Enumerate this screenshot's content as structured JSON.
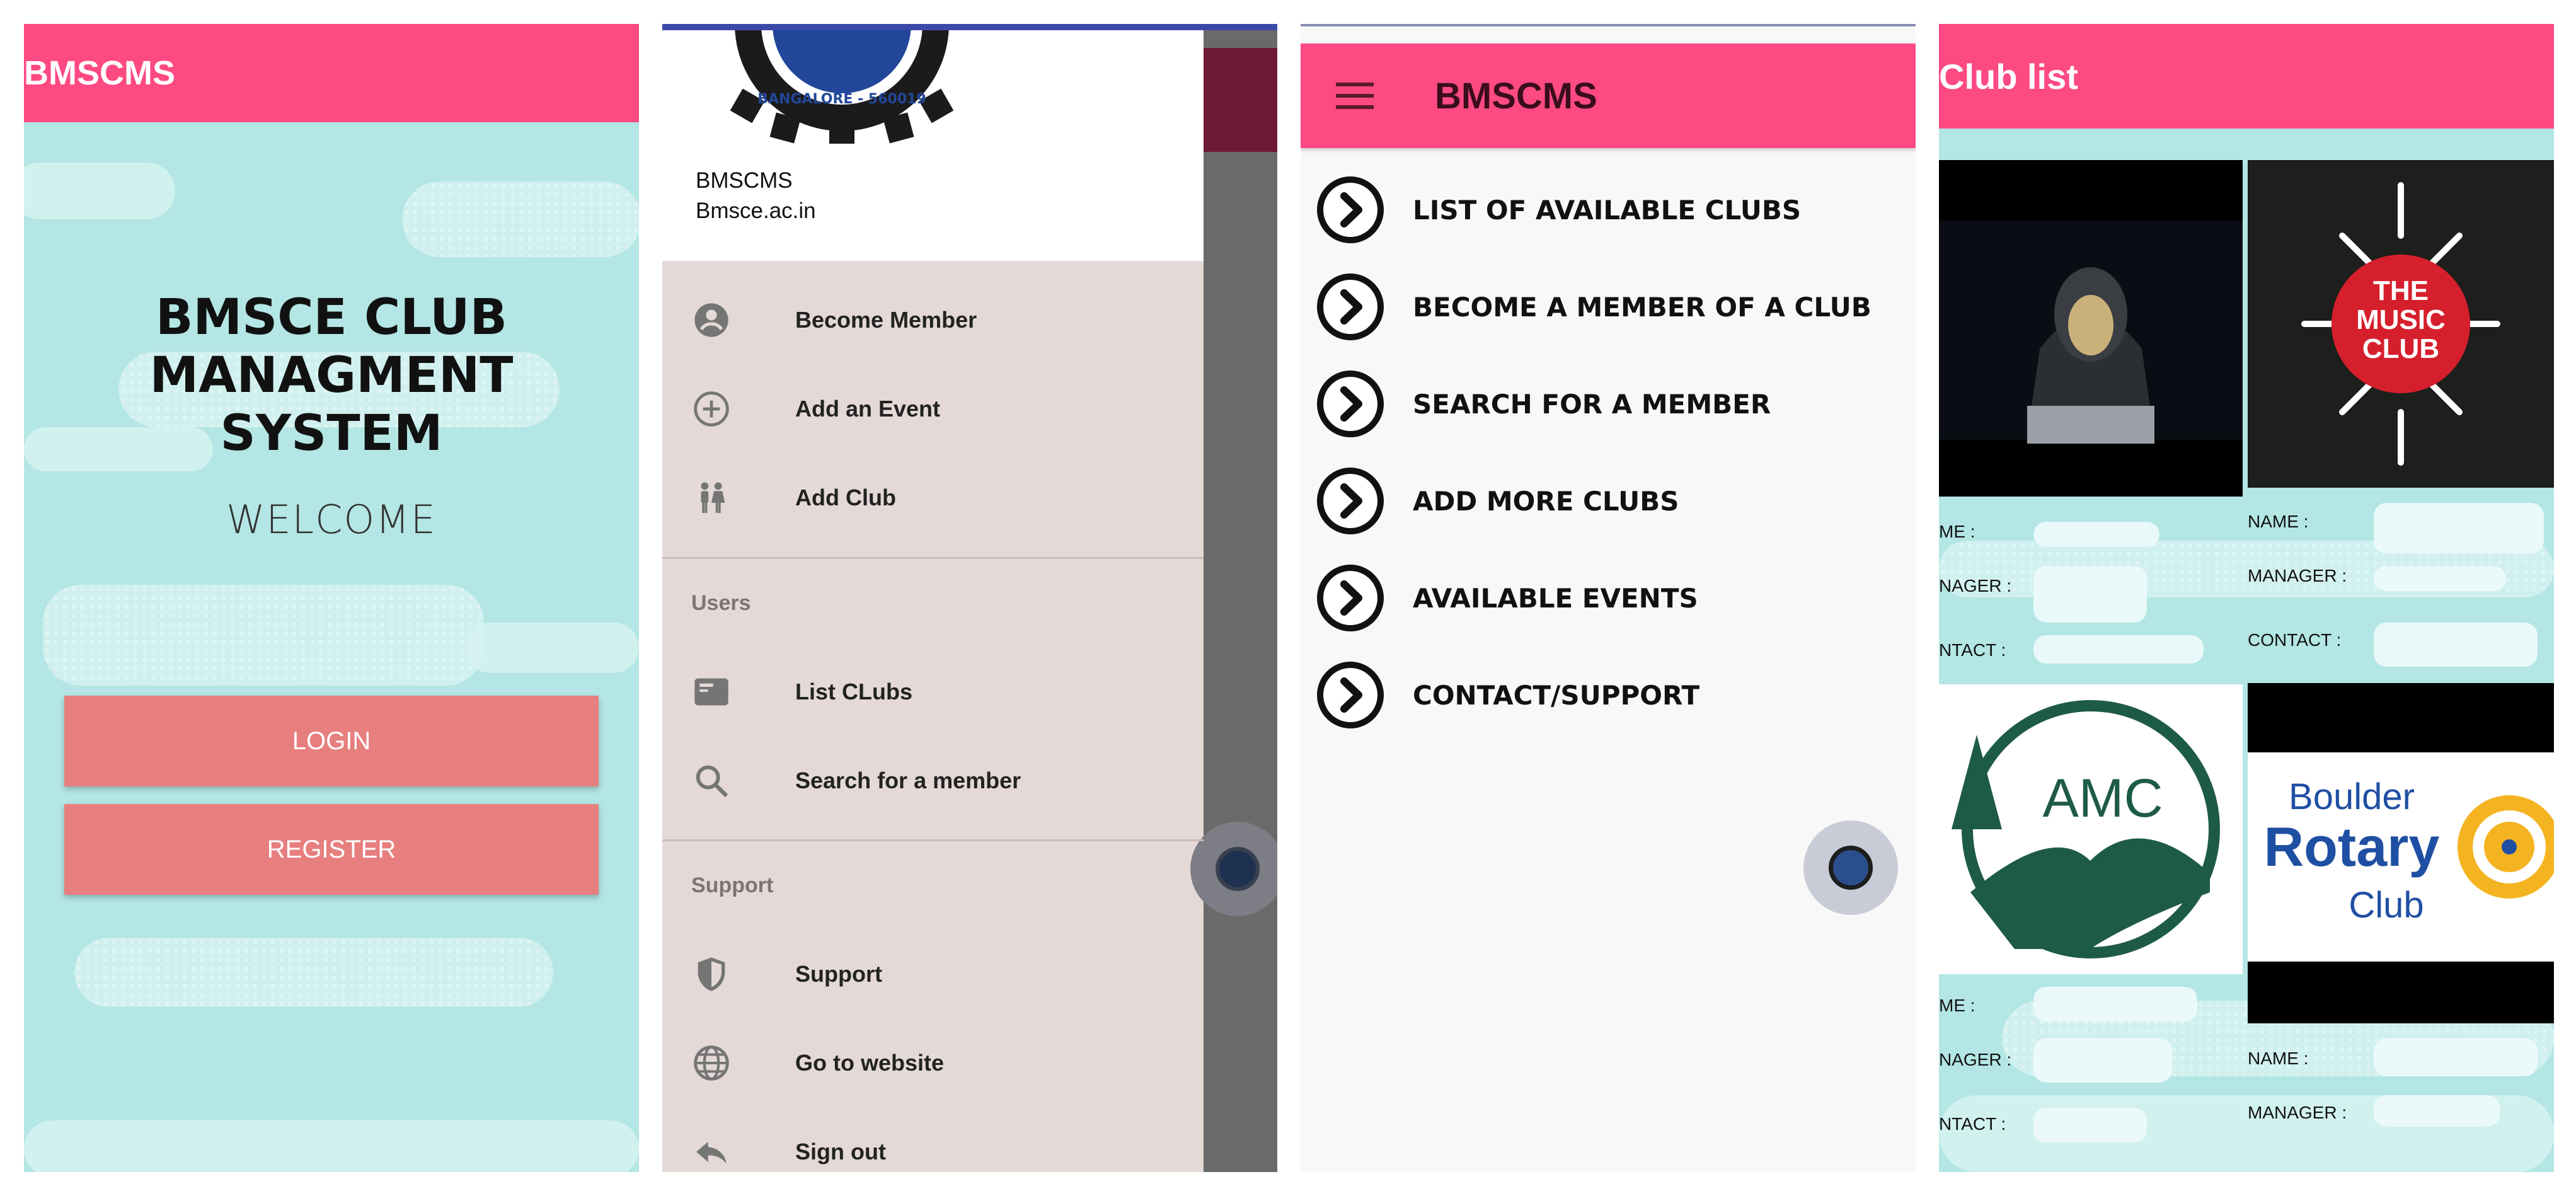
{
  "screen1": {
    "app_title": "BMSCMS",
    "title_line1": "BMSCE CLUB MANAGMENT",
    "title_line2": "SYSTEM",
    "welcome": "WELCOME",
    "login_label": "LOGIN",
    "register_label": "REGISTER"
  },
  "screen2": {
    "logo_text": "BANGALORE - 560019",
    "app_name": "BMSCMS",
    "website": "Bmsce.ac.in",
    "items": [
      {
        "label": "Become Member",
        "icon": "account-circle-icon"
      },
      {
        "label": "Add an Event",
        "icon": "add-circle-icon"
      },
      {
        "label": "Add Club",
        "icon": "people-icon"
      }
    ],
    "users_section": "Users",
    "users_items": [
      {
        "label": "List CLubs",
        "icon": "list-card-icon"
      },
      {
        "label": "Search for a member",
        "icon": "search-icon"
      }
    ],
    "support_section": "Support",
    "support_items": [
      {
        "label": "Support",
        "icon": "shield-icon"
      },
      {
        "label": "Go to website",
        "icon": "globe-icon"
      },
      {
        "label": "Sign  out",
        "icon": "reply-icon"
      }
    ]
  },
  "screen3": {
    "app_title": "BMSCMS",
    "menu": [
      "LIST OF AVAILABLE CLUBS",
      "BECOME A MEMBER OF A CLUB",
      "SEARCH FOR A MEMBER",
      "ADD MORE CLUBS",
      "AVAILABLE EVENTS",
      "CONTACT/SUPPORT"
    ]
  },
  "screen4": {
    "title": "Club list",
    "music_club_line1": "THE",
    "music_club_line2": "MUSIC",
    "music_club_line3": "CLUB",
    "amc_text": "AMC",
    "rotary_line1": "Boulder",
    "rotary_line2": "Rotary",
    "rotary_line3": "Club",
    "left_name": "ME :",
    "left_manager": "NAGER :",
    "left_contact": "NTACT :",
    "right_name": "NAME :",
    "right_manager": "MANAGER :",
    "right_contact": "CONTACT :"
  },
  "colors": {
    "appbar": "#fd4a82",
    "button": "#e77f7f",
    "sky": "#b3e6e4",
    "drawer_bg": "#e4d9d6"
  }
}
